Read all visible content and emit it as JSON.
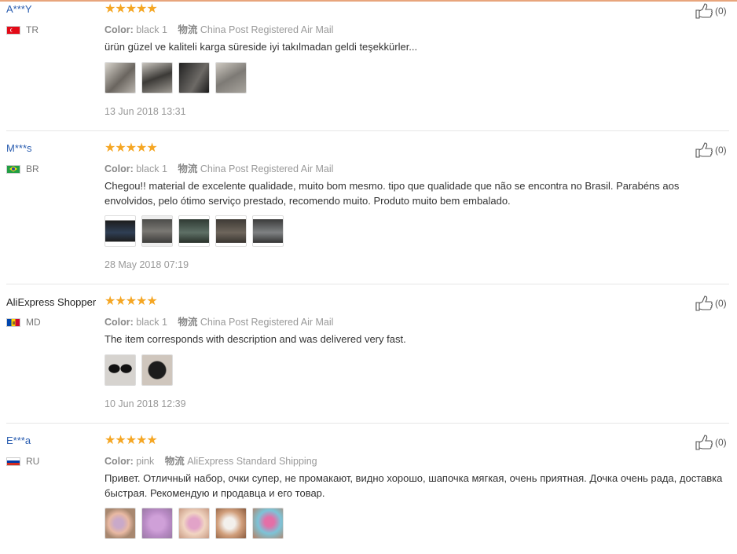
{
  "reviews": [
    {
      "user": "A***Y",
      "country": "TR",
      "stars": "★★★★★",
      "color_label": "Color:",
      "color": "black 1",
      "ship_label": "物流",
      "shipping": "China Post Registered Air Mail",
      "text": "ürün güzel ve kaliteli karga süreside iyi takılmadan geldi teşekkürler...",
      "date": "13 Jun 2018 13:31",
      "likes": "(0)",
      "photo_count": 4
    },
    {
      "user": "M***s",
      "country": "BR",
      "stars": "★★★★★",
      "color_label": "Color:",
      "color": "black 1",
      "ship_label": "物流",
      "shipping": "China Post Registered Air Mail",
      "text": "Chegou!! material de excelente qualidade, muito bom mesmo. tipo que qualidade que não se encontra no Brasil. Parabéns aos envolvidos, pelo ótimo serviço prestado, recomendo muito. Produto muito bem embalado.",
      "date": "28 May 2018 07:19",
      "likes": "(0)",
      "photo_count": 5
    },
    {
      "user": "AliExpress Shopper",
      "country": "MD",
      "stars": "★★★★★",
      "color_label": "Color:",
      "color": "black 1",
      "ship_label": "物流",
      "shipping": "China Post Registered Air Mail",
      "text": "The item corresponds with description and was delivered very fast.",
      "date": "10 Jun 2018 12:39",
      "likes": "(0)",
      "photo_count": 2
    },
    {
      "user": "E***a",
      "country": "RU",
      "stars": "★★★★★",
      "color_label": "Color:",
      "color": "pink",
      "ship_label": "物流",
      "shipping": "AliExpress Standard Shipping",
      "text": "Привет. Отличный набор, очки супер, не промакают, видно хорошо, шапочка мягкая, очень приятная. Дочка очень рада, доставка быстрая. Рекомендую и продавца и его товар.",
      "date": "",
      "likes": "(0)",
      "photo_count": 5
    }
  ],
  "colors": {
    "star": "#f5a623",
    "username_link": "#2a5db0",
    "meta_text": "#999999",
    "top_border": "#e8a57c"
  }
}
